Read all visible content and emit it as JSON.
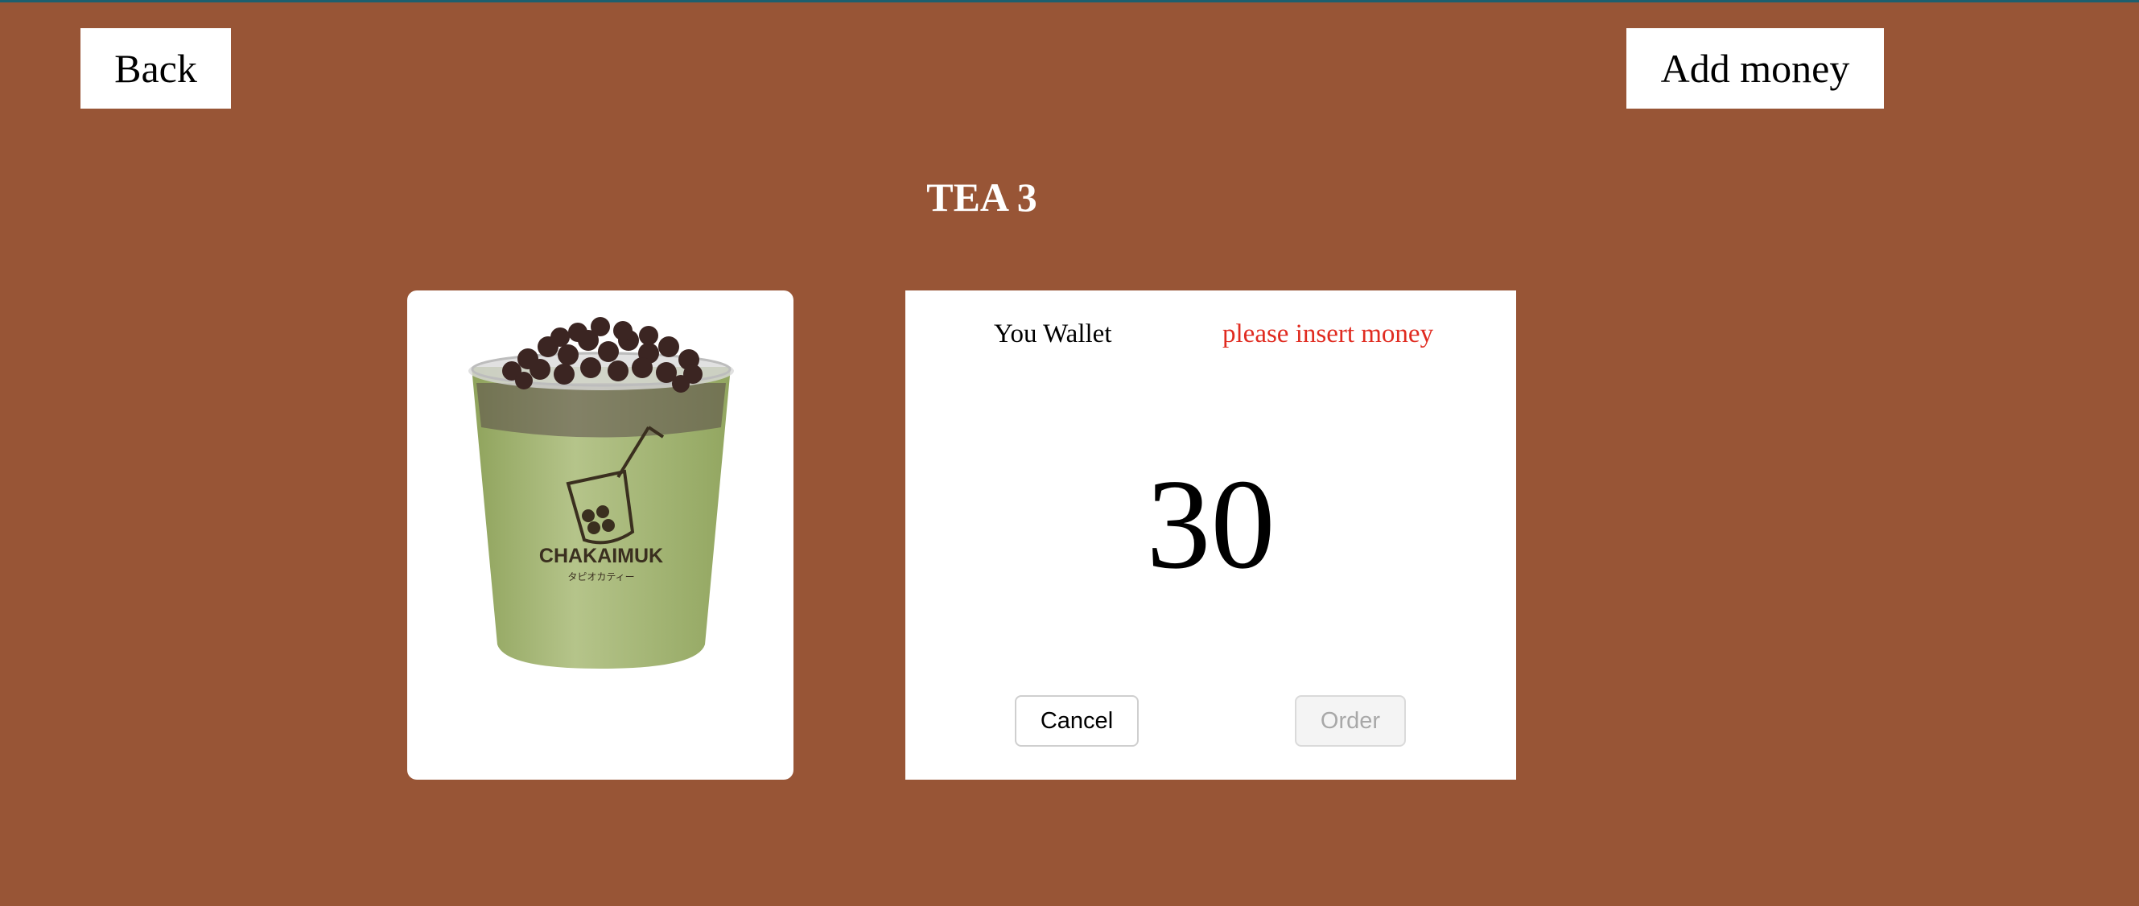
{
  "nav": {
    "back_label": "Back",
    "add_money_label": "Add money"
  },
  "product": {
    "title": "TEA 3",
    "image_brand": "CHAKAIMUK",
    "image_subtext": "タピオカティー"
  },
  "wallet": {
    "label": "You Wallet",
    "warning": "please insert money",
    "amount": "30",
    "cancel_label": "Cancel",
    "order_label": "Order"
  },
  "colors": {
    "background": "#985536",
    "warning": "#e02b20",
    "card": "#ffffff",
    "disabled_text": "#a8a8a8"
  }
}
